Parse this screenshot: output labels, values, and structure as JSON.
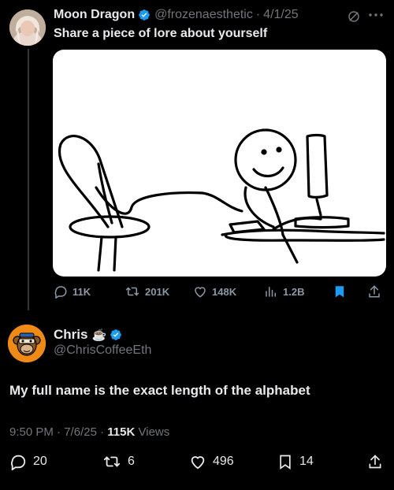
{
  "original_tweet": {
    "display_name": "Moon Dragon",
    "handle": "@frozenaesthetic",
    "separator": "·",
    "date": "4/1/25",
    "text": "Share a piece of lore about yourself",
    "actions": {
      "replies": "11K",
      "retweets": "201K",
      "likes": "148K",
      "views": "1.2B"
    },
    "icons": [
      "grok-icon",
      "more-icon",
      "reply-icon",
      "retweet-icon",
      "like-icon",
      "views-icon",
      "bookmark-icon",
      "share-icon"
    ]
  },
  "reply_tweet": {
    "display_name": "Chris",
    "name_emoji": "☕",
    "handle": "@ChrisCoffeeEth",
    "text": "My full name is the exact length of the alphabet",
    "time": "9:50 PM",
    "date": "7/6/25",
    "views_count": "115K",
    "views_label": "Views",
    "dot": "·",
    "actions": {
      "replies": "20",
      "retweets": "6",
      "likes": "496",
      "bookmarks": "14"
    }
  },
  "colors": {
    "background": "#000000",
    "text": "#e7e9ea",
    "muted": "#71767b",
    "verified_blue": "#1d9bf0",
    "bookmark_blue": "#1d9bf0"
  }
}
